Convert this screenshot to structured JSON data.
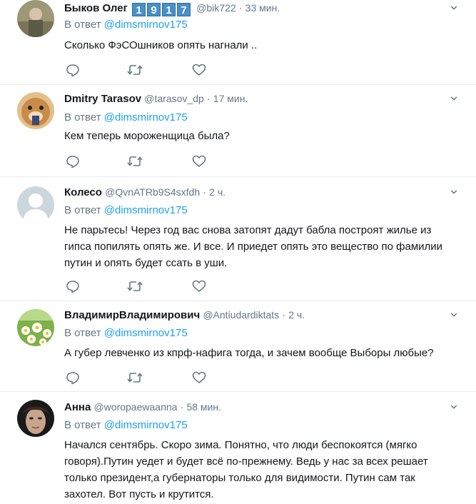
{
  "tweets": [
    {
      "name": "Быков Олег",
      "badges": [
        "1",
        "9",
        "1",
        "7"
      ],
      "handle": "@bik722",
      "time": "33 мин.",
      "reply_prefix": "В ответ",
      "reply_to": "@dimsmirnov175",
      "lines": [
        "Сколько ФэСОшников опять нагнали .."
      ]
    },
    {
      "name": "Dmitry Tarasov",
      "handle": "@tarasov_dp",
      "time": "17 мин.",
      "reply_prefix": "В ответ",
      "reply_to": "@dimsmirnov175",
      "lines": [
        "Кем теперь мороженщица была?"
      ]
    },
    {
      "name": "Колесо",
      "handle": "@QvnATRb9S4sxfdh",
      "time": "2 ч.",
      "reply_prefix": "В ответ",
      "reply_to": "@dimsmirnov175",
      "lines": [
        "Не парьтесь! Через год вас снова затопят дадут бабла построят жилье из",
        "гипса попилять опять же. И все. И приедет опять это вещество по фамилии",
        "путин и опять будет ссать в уши."
      ]
    },
    {
      "name": "ВладимирВладимирович",
      "handle": "@Antiudardiktats",
      "time": "2 ч.",
      "reply_prefix": "В ответ",
      "reply_to": "@dimsmirnov175",
      "lines": [
        "А губер левченко из кпрф-нафига тогда, и зачем вообще Выборы любые?"
      ]
    },
    {
      "name": "Анна",
      "handle": "@woropaewaanna",
      "time": "58 мин.",
      "reply_prefix": "В ответ",
      "reply_to": "@dimsmirnov175",
      "lines": [
        "Начался сентябрь. Скоро зима. Понятно, что люди беспокоятся (мягко",
        "говоря).Путин уедет и будет всё по-прежнему. Ведь у нас за всех решает",
        "только президент,а губернаторы только для видимости. Путин сам так",
        "захотел. Вот пусть и крутится."
      ]
    }
  ],
  "separator": "·",
  "icons": [
    "reply-icon",
    "retweet-icon",
    "like-icon",
    "chevron-down-icon"
  ],
  "colors": {
    "link": "#1da1f2",
    "secondary": "#657786",
    "badge": "#4a90c8",
    "divider": "#e6ecf0"
  }
}
